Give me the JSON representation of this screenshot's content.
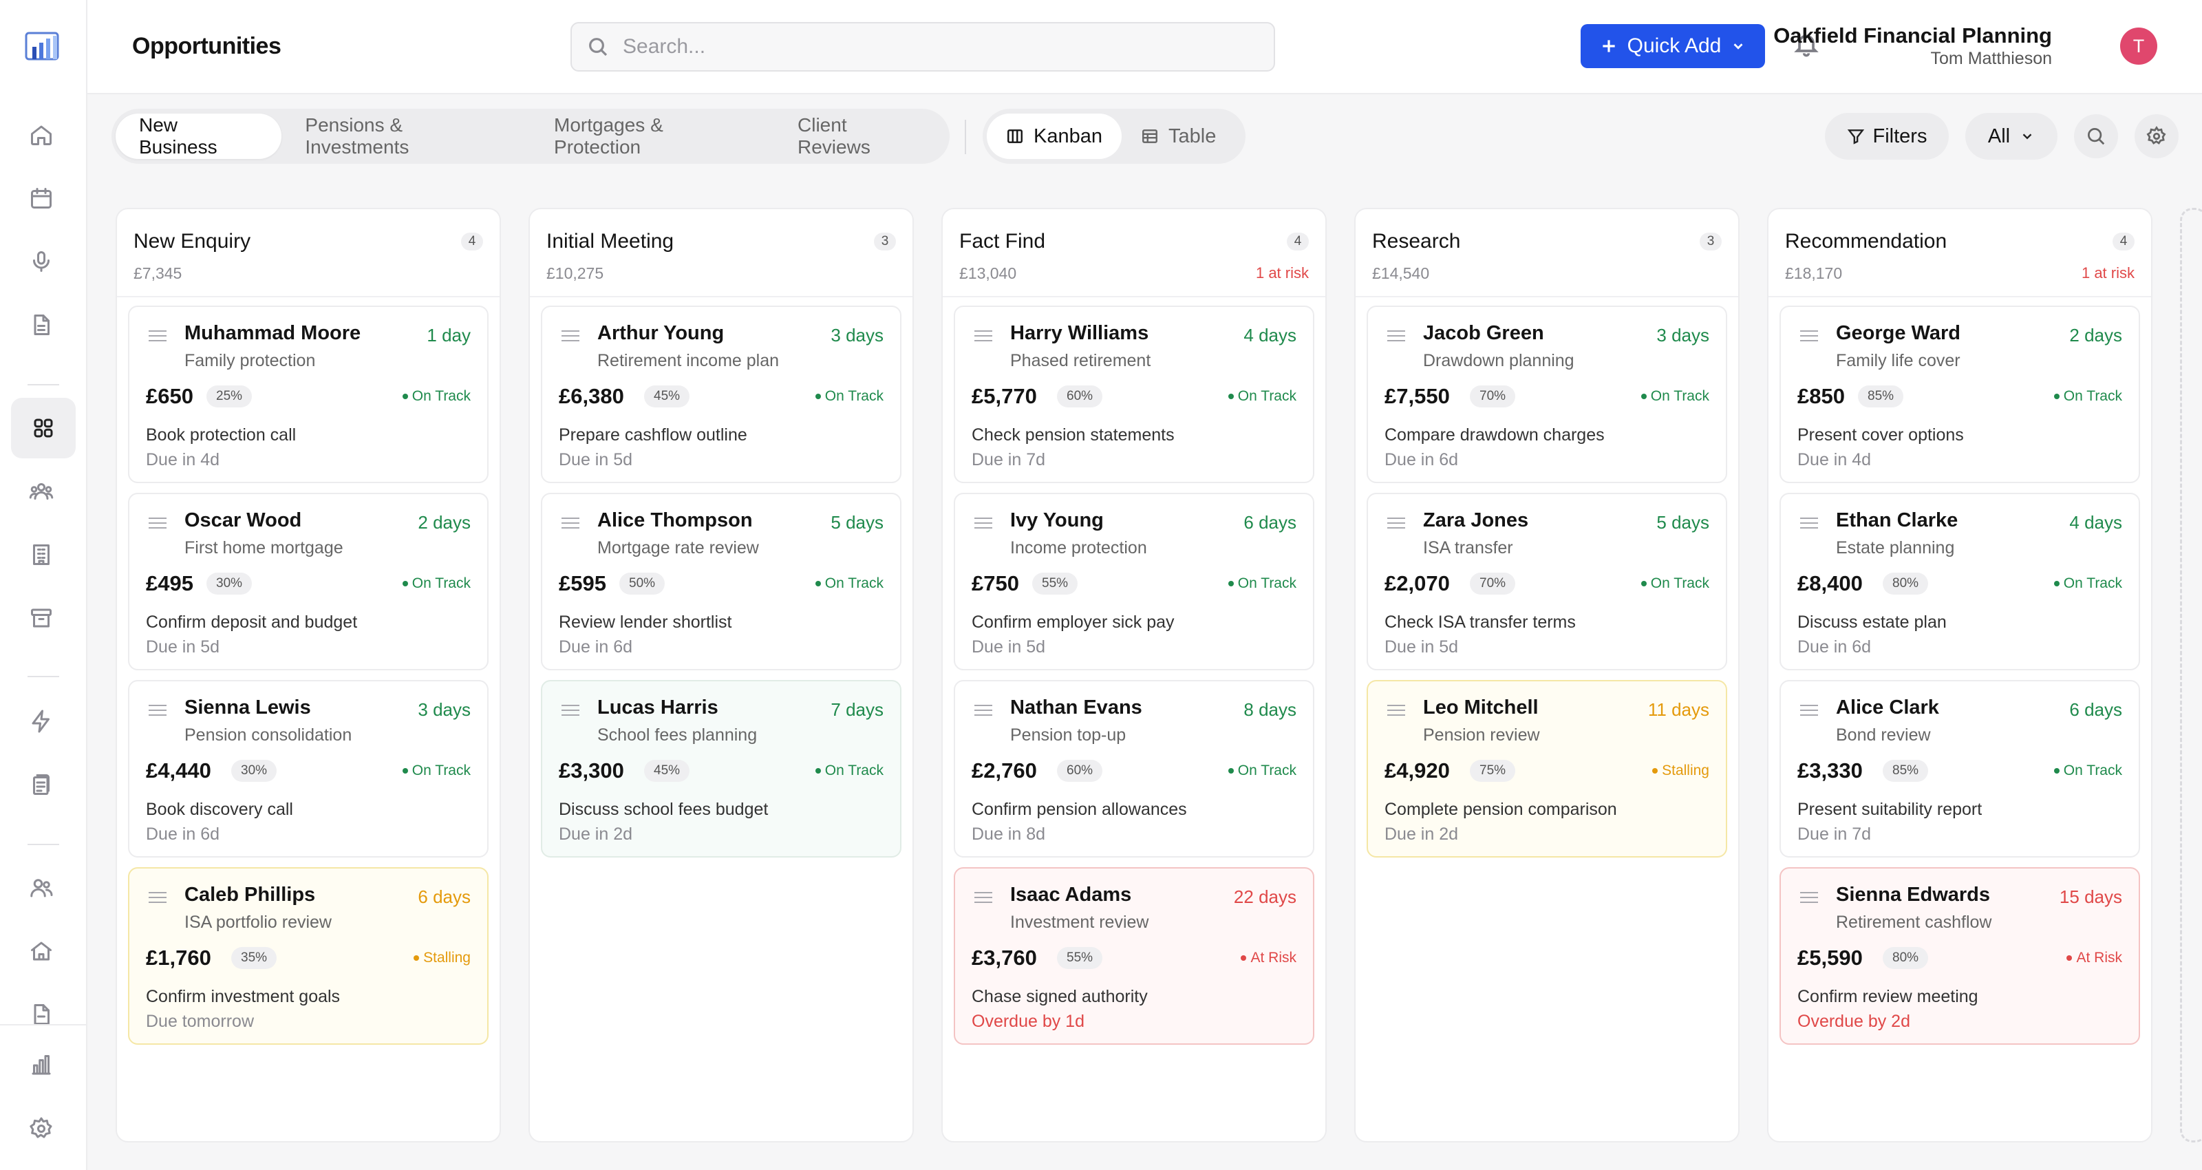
{
  "sidebar": {
    "logo_icon": "bar-chart-logo",
    "items": [
      {
        "icon": "home-icon"
      },
      {
        "icon": "calendar-icon"
      },
      {
        "icon": "microphone-icon"
      },
      {
        "icon": "document-icon"
      },
      {
        "icon": "grid-icon",
        "active": true
      },
      {
        "icon": "group-icon"
      },
      {
        "icon": "building-icon"
      },
      {
        "icon": "archive-icon"
      },
      {
        "icon": "lightning-icon"
      },
      {
        "icon": "clipboard-icon"
      },
      {
        "icon": "users-icon"
      },
      {
        "icon": "house-icon"
      },
      {
        "icon": "file-icon"
      },
      {
        "icon": "analytics-icon"
      },
      {
        "icon": "settings-icon"
      }
    ]
  },
  "header": {
    "title": "Opportunities",
    "search_placeholder": "Search...",
    "quick_add_label": "Quick Add",
    "org_name": "Oakfield Financial Planning",
    "user_name": "Tom Matthieson",
    "avatar_initial": "T"
  },
  "toolbar": {
    "pipeline_tabs": [
      "New Business",
      "Pensions & Investments",
      "Mortgages & Protection",
      "Client Reviews"
    ],
    "active_pipeline": "New Business",
    "view_tabs": [
      "Kanban",
      "Table"
    ],
    "active_view": "Kanban",
    "filters_label": "Filters",
    "scope_label": "All"
  },
  "colors": {
    "accent": "#2253ea",
    "on_track": "#1f8a4c",
    "stalling": "#e49a0c",
    "at_risk": "#e04848",
    "avatar": "#e0476d"
  },
  "columns": [
    {
      "title": "New Enquiry",
      "count": "4",
      "total": "£7,345",
      "risk": "",
      "cards": [
        {
          "name": "Muhammad Moore",
          "subtitle": "Family protection",
          "age": "1 day",
          "value": "£650",
          "pct": "25%",
          "status": "On Track",
          "task": "Book protection call",
          "due": "Due in 4d",
          "tone": "ok"
        },
        {
          "name": "Oscar Wood",
          "subtitle": "First home mortgage",
          "age": "2 days",
          "value": "£495",
          "pct": "30%",
          "status": "On Track",
          "task": "Confirm deposit and budget",
          "due": "Due in 5d",
          "tone": "ok"
        },
        {
          "name": "Sienna Lewis",
          "subtitle": "Pension consolidation",
          "age": "3 days",
          "value": "£4,440",
          "pct": "30%",
          "status": "On Track",
          "task": "Book discovery call",
          "due": "Due in 6d",
          "tone": "ok"
        },
        {
          "name": "Caleb Phillips",
          "subtitle": "ISA portfolio review",
          "age": "6 days",
          "value": "£1,760",
          "pct": "35%",
          "status": "Stalling",
          "task": "Confirm investment goals",
          "due": "Due tomorrow",
          "tone": "warn"
        }
      ]
    },
    {
      "title": "Initial Meeting",
      "count": "3",
      "total": "£10,275",
      "risk": "",
      "cards": [
        {
          "name": "Arthur Young",
          "subtitle": "Retirement income plan",
          "age": "3 days",
          "value": "£6,380",
          "pct": "45%",
          "status": "On Track",
          "task": "Prepare cashflow outline",
          "due": "Due in 5d",
          "tone": "ok"
        },
        {
          "name": "Alice Thompson",
          "subtitle": "Mortgage rate review",
          "age": "5 days",
          "value": "£595",
          "pct": "50%",
          "status": "On Track",
          "task": "Review lender shortlist",
          "due": "Due in 6d",
          "tone": "ok"
        },
        {
          "name": "Lucas Harris",
          "subtitle": "School fees planning",
          "age": "7 days",
          "value": "£3,300",
          "pct": "45%",
          "status": "On Track",
          "task": "Discuss school fees budget",
          "due": "Due in 2d",
          "tone": "ok-tint"
        }
      ]
    },
    {
      "title": "Fact Find",
      "count": "4",
      "total": "£13,040",
      "risk": "1 at risk",
      "cards": [
        {
          "name": "Harry Williams",
          "subtitle": "Phased retirement",
          "age": "4 days",
          "value": "£5,770",
          "pct": "60%",
          "status": "On Track",
          "task": "Check pension statements",
          "due": "Due in 7d",
          "tone": "ok"
        },
        {
          "name": "Ivy Young",
          "subtitle": "Income protection",
          "age": "6 days",
          "value": "£750",
          "pct": "55%",
          "status": "On Track",
          "task": "Confirm employer sick pay",
          "due": "Due in 5d",
          "tone": "ok"
        },
        {
          "name": "Nathan Evans",
          "subtitle": "Pension top-up",
          "age": "8 days",
          "value": "£2,760",
          "pct": "60%",
          "status": "On Track",
          "task": "Confirm pension allowances",
          "due": "Due in 8d",
          "tone": "ok"
        },
        {
          "name": "Isaac Adams",
          "subtitle": "Investment review",
          "age": "22 days",
          "value": "£3,760",
          "pct": "55%",
          "status": "At Risk",
          "task": "Chase signed authority",
          "due": "Overdue by 1d",
          "tone": "bad"
        }
      ]
    },
    {
      "title": "Research",
      "count": "3",
      "total": "£14,540",
      "risk": "",
      "cards": [
        {
          "name": "Jacob Green",
          "subtitle": "Drawdown planning",
          "age": "3 days",
          "value": "£7,550",
          "pct": "70%",
          "status": "On Track",
          "task": "Compare drawdown charges",
          "due": "Due in 6d",
          "tone": "ok"
        },
        {
          "name": "Zara Jones",
          "subtitle": "ISA transfer",
          "age": "5 days",
          "value": "£2,070",
          "pct": "70%",
          "status": "On Track",
          "task": "Check ISA transfer terms",
          "due": "Due in 5d",
          "tone": "ok"
        },
        {
          "name": "Leo Mitchell",
          "subtitle": "Pension review",
          "age": "11 days",
          "value": "£4,920",
          "pct": "75%",
          "status": "Stalling",
          "task": "Complete pension comparison",
          "due": "Due in 2d",
          "tone": "warn"
        }
      ]
    },
    {
      "title": "Recommendation",
      "count": "4",
      "total": "£18,170",
      "risk": "1 at risk",
      "cards": [
        {
          "name": "George Ward",
          "subtitle": "Family life cover",
          "age": "2 days",
          "value": "£850",
          "pct": "85%",
          "status": "On Track",
          "task": "Present cover options",
          "due": "Due in 4d",
          "tone": "ok"
        },
        {
          "name": "Ethan Clarke",
          "subtitle": "Estate planning",
          "age": "4 days",
          "value": "£8,400",
          "pct": "80%",
          "status": "On Track",
          "task": "Discuss estate plan",
          "due": "Due in 6d",
          "tone": "ok"
        },
        {
          "name": "Alice Clark",
          "subtitle": "Bond review",
          "age": "6 days",
          "value": "£3,330",
          "pct": "85%",
          "status": "On Track",
          "task": "Present suitability report",
          "due": "Due in 7d",
          "tone": "ok"
        },
        {
          "name": "Sienna Edwards",
          "subtitle": "Retirement cashflow",
          "age": "15 days",
          "value": "£5,590",
          "pct": "80%",
          "status": "At Risk",
          "task": "Confirm review meeting",
          "due": "Overdue by 2d",
          "tone": "bad"
        }
      ]
    }
  ]
}
